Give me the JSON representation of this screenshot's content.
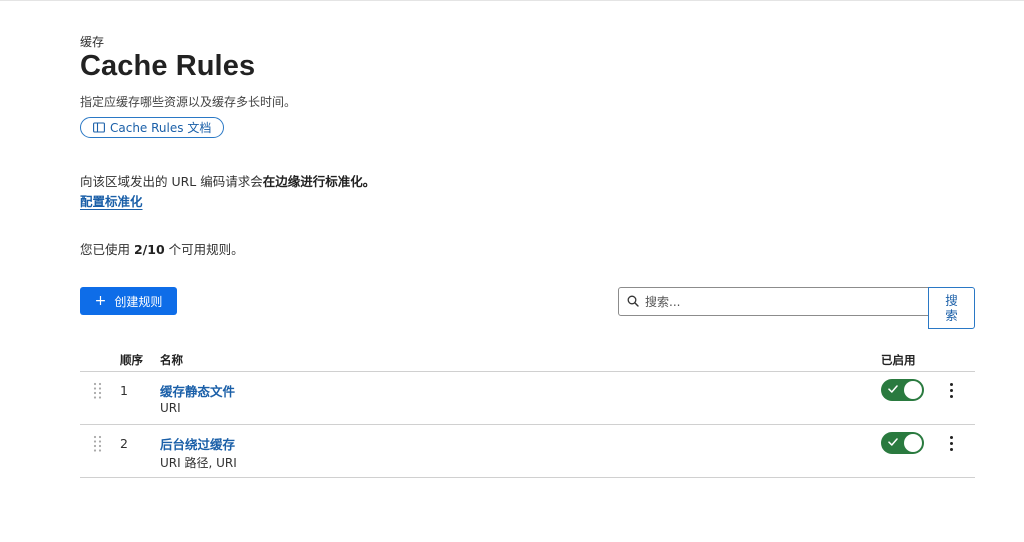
{
  "header": {
    "eyebrow": "缓存",
    "title": "Cache Rules",
    "subtitle": "指定应缓存哪些资源以及缓存多长时间。",
    "docs_link": "Cache Rules 文档"
  },
  "normalization": {
    "text_prefix": "向该区域发出的 URL 编码请求会",
    "text_bold": "在边缘进行标准化。",
    "link": "配置标准化"
  },
  "usage": {
    "prefix": "您已使用 ",
    "count": "2/10",
    "suffix": " 个可用规则。"
  },
  "toolbar": {
    "create_icon": "plus-icon",
    "create_label": "创建规则",
    "search_placeholder": "搜索...",
    "search_button": "搜索"
  },
  "table": {
    "columns": {
      "order": "顺序",
      "name": "名称",
      "enabled": "已启用"
    },
    "rows": [
      {
        "order": "1",
        "name": "缓存静态文件",
        "sub": "URI",
        "enabled": true
      },
      {
        "order": "2",
        "name": "后台绕过缓存",
        "sub": "URI 路径, URI",
        "enabled": true
      }
    ]
  },
  "colors": {
    "primary": "#0e6de8",
    "link": "#1a5fa8",
    "toggle_on": "#2a7a3f"
  }
}
